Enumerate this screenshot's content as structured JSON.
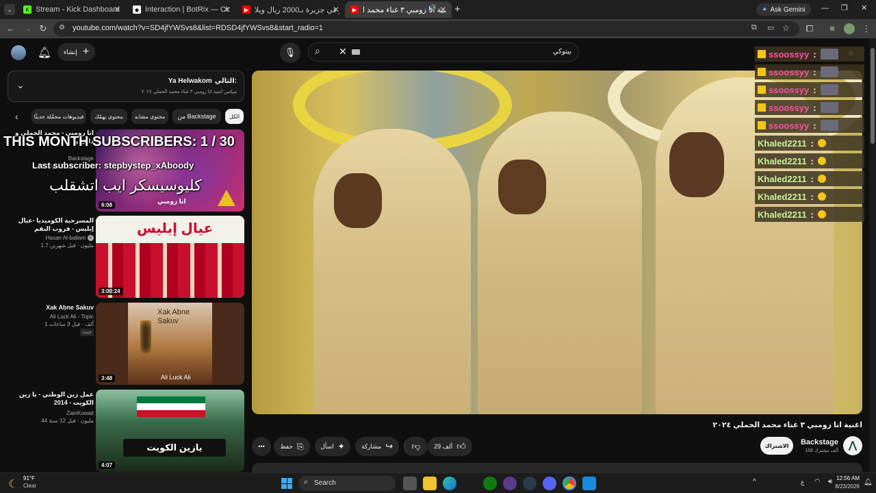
{
  "browser": {
    "tabs": [
      {
        "title": "Stream - Kick Dashboard",
        "icon": "kick-icon",
        "color": "#53fc18"
      },
      {
        "title": "Interaction | BotRix — Cloud St",
        "icon": "botrix-icon",
        "color": "#ffffff"
      },
      {
        "title": "فالكونز في جزيرة بـ2000 ريال ويلا",
        "icon": "youtube-icon",
        "color": "#ff0000"
      },
      {
        "title": "اغنية انا زومبي ٣ غناء محمد ا",
        "icon": "youtube-icon",
        "color": "#ff0000"
      }
    ],
    "ask_gemini": "Ask Gemini",
    "url": "youtube.com/watch?v=SD4jfYWSvs8&list=RDSD4jfYWSvs8&start_radio=1"
  },
  "youtube": {
    "create_label": "إنشاء",
    "search_value": "بيتوكي",
    "queue": {
      "next_prefix": "التالي:",
      "next_title": "Ya Helwakom",
      "subtitle": "ميكس اغنية انا زومبي ٣ غناء محمد الحملي ٢٠٢٤"
    },
    "chips": [
      "الكل",
      "من Backstage",
      "محتوى مشابه",
      "محتوى يهمّك",
      "فيديوهات محمَّلة حديثًا"
    ],
    "recommendations": [
      {
        "title": "انا زومبي - محمد الحملي و داني و",
        "channel": "Backstage",
        "stats": "14 مليون · قبل 5 سنوات",
        "duration": "6:08"
      },
      {
        "title": "المسرحية الكوميديا -عيال إبليس - فروب البقم",
        "channel": "Hasan Al-ballam",
        "stats": "1.7 مليون · قبل شهرين",
        "duration": "3:00:24"
      },
      {
        "title": "Xak Abne Sakuv",
        "channel": "Ali Luck Ali - Topic",
        "stats": "1 ألف · قبل 3 ساعات",
        "badge": "جديد",
        "duration": "3:48"
      },
      {
        "title": "عمل زين الوطني - يا زين الكويت - 2014",
        "channel": "ZainKuwait",
        "stats": "44 مليون · قبل 12 سنة",
        "duration": "4:07"
      }
    ],
    "thumb_text": {
      "zombie": "انا زومبي",
      "iblis": "عيال إبليس",
      "xak": "Xak Abne Sakuv",
      "xak_artist": "Ali Luck Ali",
      "zain": "يازين الكويت"
    },
    "video": {
      "title": "اغنية انا زومبي ٣ غناء محمد الحملي ٢٠٢٤",
      "channel": "Backstage",
      "subscribers": "158 ألف مشترك",
      "subscribe_label": "الاشتراك",
      "likes": "29 ألف",
      "share_label": "مشاركة",
      "ask_label": "اسأل",
      "save_label": "حفظ"
    }
  },
  "overlay": {
    "subs_goal": "THIS MONTH SUBSCRIBERS: 1 / 30",
    "last_sub": "Last subscriber: stepbystep_xAboody",
    "arabic_banner": "كليوسيسكر ايب اتشقلب",
    "chat": [
      {
        "name": "ssoossyy",
        "sep": ":",
        "style": "pink"
      },
      {
        "name": "ssoossyy",
        "sep": ":",
        "style": "pink"
      },
      {
        "name": "ssoossyy",
        "sep": ":",
        "style": "pink"
      },
      {
        "name": "ssoossyy",
        "sep": ":",
        "style": "pink"
      },
      {
        "name": "ssoossyy",
        "sep": ":",
        "style": "pink"
      },
      {
        "name": "Khaled2211",
        "sep": ":",
        "style": "green"
      },
      {
        "name": "Khaled2211",
        "sep": ":",
        "style": "green"
      },
      {
        "name": "Khaled2211",
        "sep": ":",
        "style": "green"
      },
      {
        "name": "Khaled2211",
        "sep": ":",
        "style": "green"
      },
      {
        "name": "Khaled2211",
        "sep": ":",
        "style": "green"
      }
    ]
  },
  "taskbar": {
    "weather_temp": "91°F",
    "weather_desc": "Clear",
    "search_placeholder": "Search",
    "time": "12:56 AM",
    "date": "8/23/2026",
    "lang": "ع"
  }
}
